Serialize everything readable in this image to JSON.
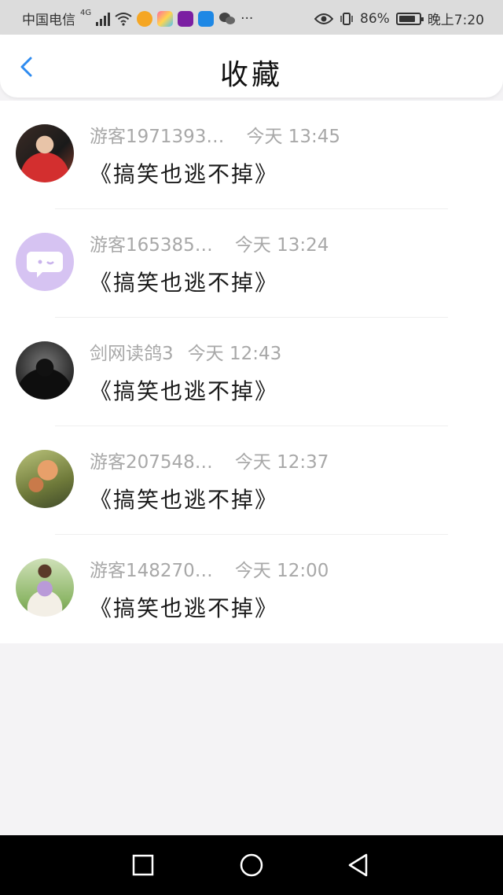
{
  "statusbar": {
    "carrier": "中国电信",
    "network": "4G",
    "battery_percent": "86%",
    "battery_level": 0.86,
    "time": "晚上7:20",
    "icons": [
      "signal-icon",
      "wifi-icon",
      "weibo-icon",
      "app-icon",
      "video-app-icon",
      "bulb-app-icon",
      "wechat-icon",
      "more-icon",
      "eye-icon",
      "vibrate-icon",
      "battery-icon",
      "leaf-icon"
    ]
  },
  "header": {
    "title": "收藏",
    "back_icon": "chevron-left-icon",
    "accent": "#2e8bf0"
  },
  "favorites": [
    {
      "user": "游客1971393…",
      "time": "今天 13:45",
      "title": "《搞笑也逃不掉》",
      "avatar": "avatar-person-red"
    },
    {
      "user": "游客165385…",
      "time": "今天 13:24",
      "title": "《搞笑也逃不掉》",
      "avatar": "avatar-default-chat"
    },
    {
      "user": "剑网读鸽3",
      "time": "今天 12:43",
      "title": "《搞笑也逃不掉》",
      "avatar": "avatar-hooded-dark"
    },
    {
      "user": "游客207548…",
      "time": "今天 12:37",
      "title": "《搞笑也逃不掉》",
      "avatar": "avatar-flower"
    },
    {
      "user": "游客148270…",
      "time": "今天 12:00",
      "title": "《搞笑也逃不掉》",
      "avatar": "avatar-bouquet"
    }
  ],
  "navbar": {
    "icons": [
      "recents-square-icon",
      "home-circle-icon",
      "back-triangle-icon"
    ]
  }
}
